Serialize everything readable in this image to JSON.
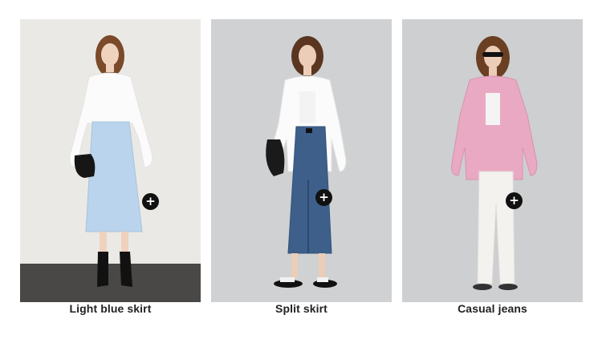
{
  "products": [
    {
      "caption": "Light blue skirt",
      "add_icon": "plus-icon",
      "background": "#ebe9e5",
      "floor": "#4a4846",
      "skirt_color": "#b9d4ec"
    },
    {
      "caption": "Split skirt",
      "add_icon": "plus-icon",
      "background": "#cfd1d3",
      "skirt_color": "#3e5f8a"
    },
    {
      "caption": "Casual jeans",
      "add_icon": "plus-icon",
      "background": "#cdcfd1",
      "shirt_color": "#eaa9c2"
    }
  ],
  "add_symbol": "+"
}
